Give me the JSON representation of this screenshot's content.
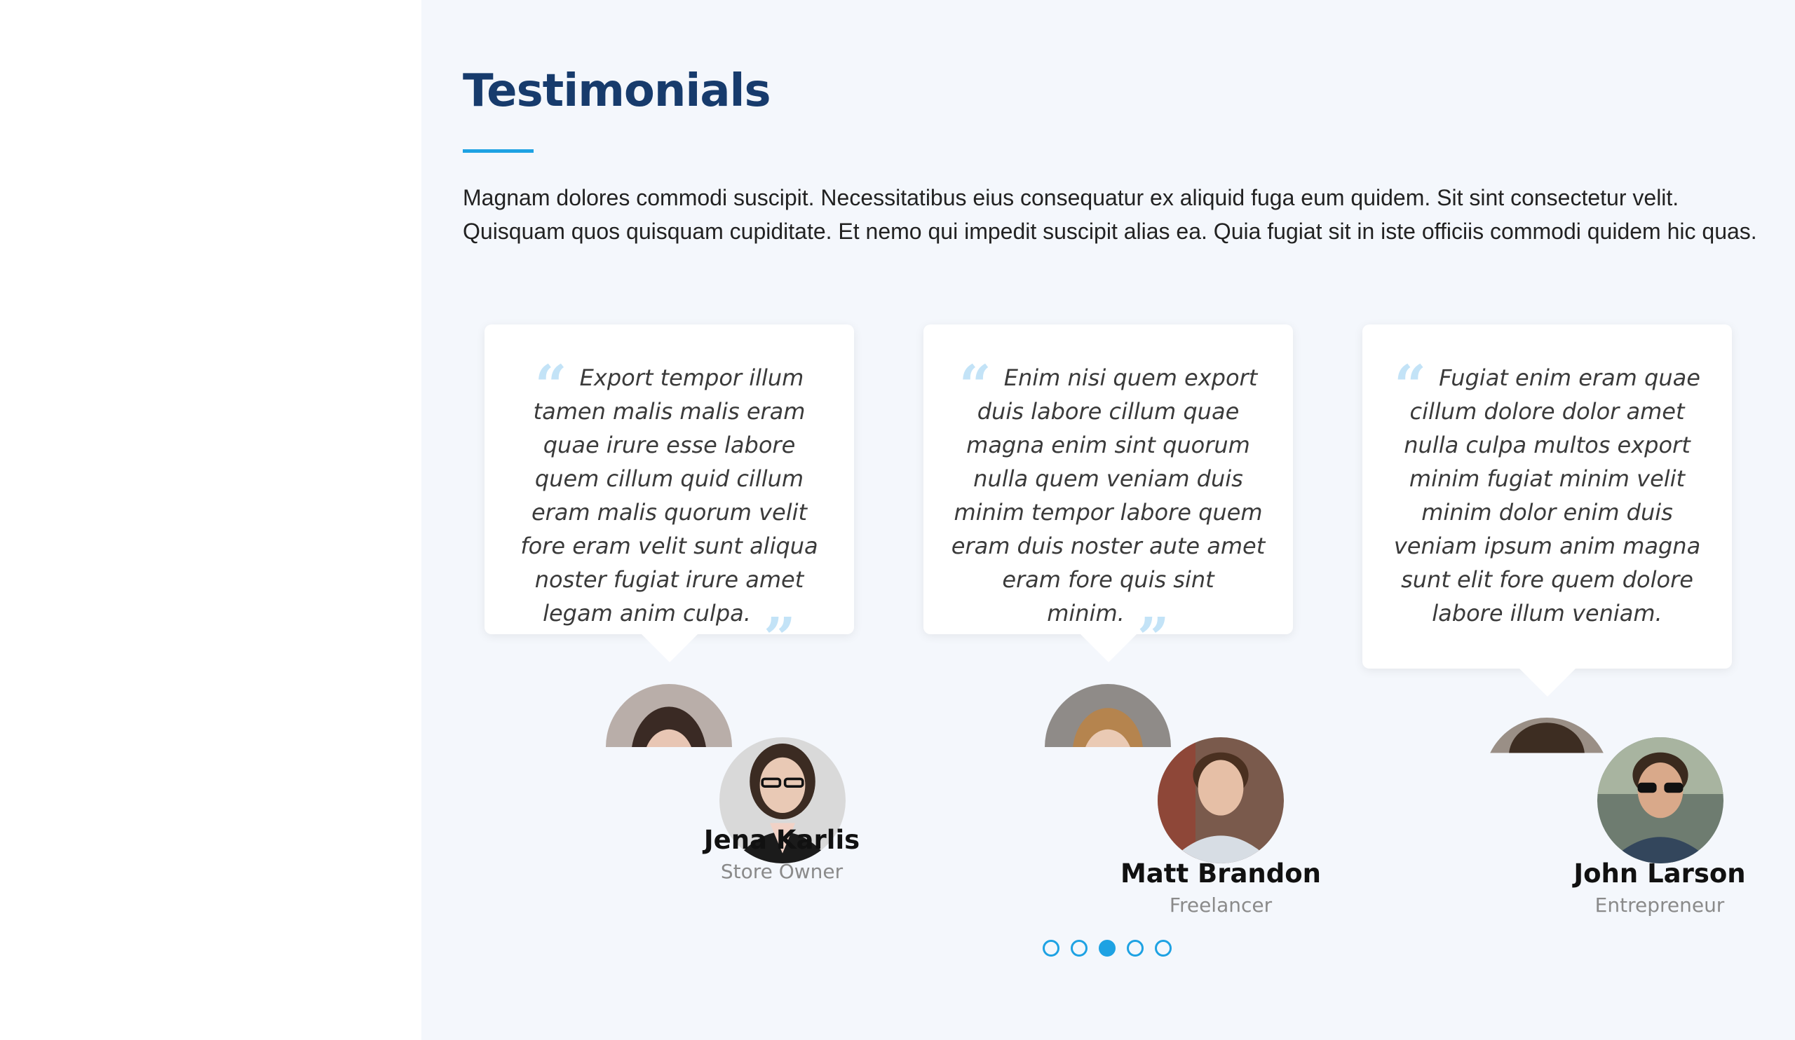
{
  "section": {
    "title": "Testimonials",
    "intro": "Magnam dolores commodi suscipit. Necessitatibus eius consequatur ex aliquid fuga eum quidem. Sit sint consectetur velit. Quisquam quos quisquam cupiditate. Et nemo qui impedit suscipit alias ea. Quia fugiat sit in iste officiis commodi quidem hic quas.",
    "accent_color": "#1ea2e3",
    "title_color": "#173b6c"
  },
  "testimonials": [
    {
      "quote": "Export tempor illum tamen malis malis eram quae irure esse labore quem cillum quid cillum eram malis quorum velit fore eram velit sunt aliqua noster fugiat irure amet legam anim culpa.",
      "name": "Jena Karlis",
      "role": "Store Owner"
    },
    {
      "quote": "Enim nisi quem export duis labore cillum quae magna enim sint quorum nulla quem veniam duis minim tempor labore quem eram duis noster aute amet eram fore quis sint minim.",
      "name": "Matt Brandon",
      "role": "Freelancer"
    },
    {
      "quote": "Fugiat enim eram quae cillum dolore dolor amet nulla culpa multos export minim fugiat minim velit minim dolor enim duis veniam ipsum anim magna sunt elit fore quem dolore labore illum veniam.",
      "name": "John Larson",
      "role": "Entrepreneur"
    }
  ],
  "quote_marks": {
    "open": "“",
    "close": "”"
  },
  "pagination": {
    "total": 5,
    "active_index": 2
  }
}
